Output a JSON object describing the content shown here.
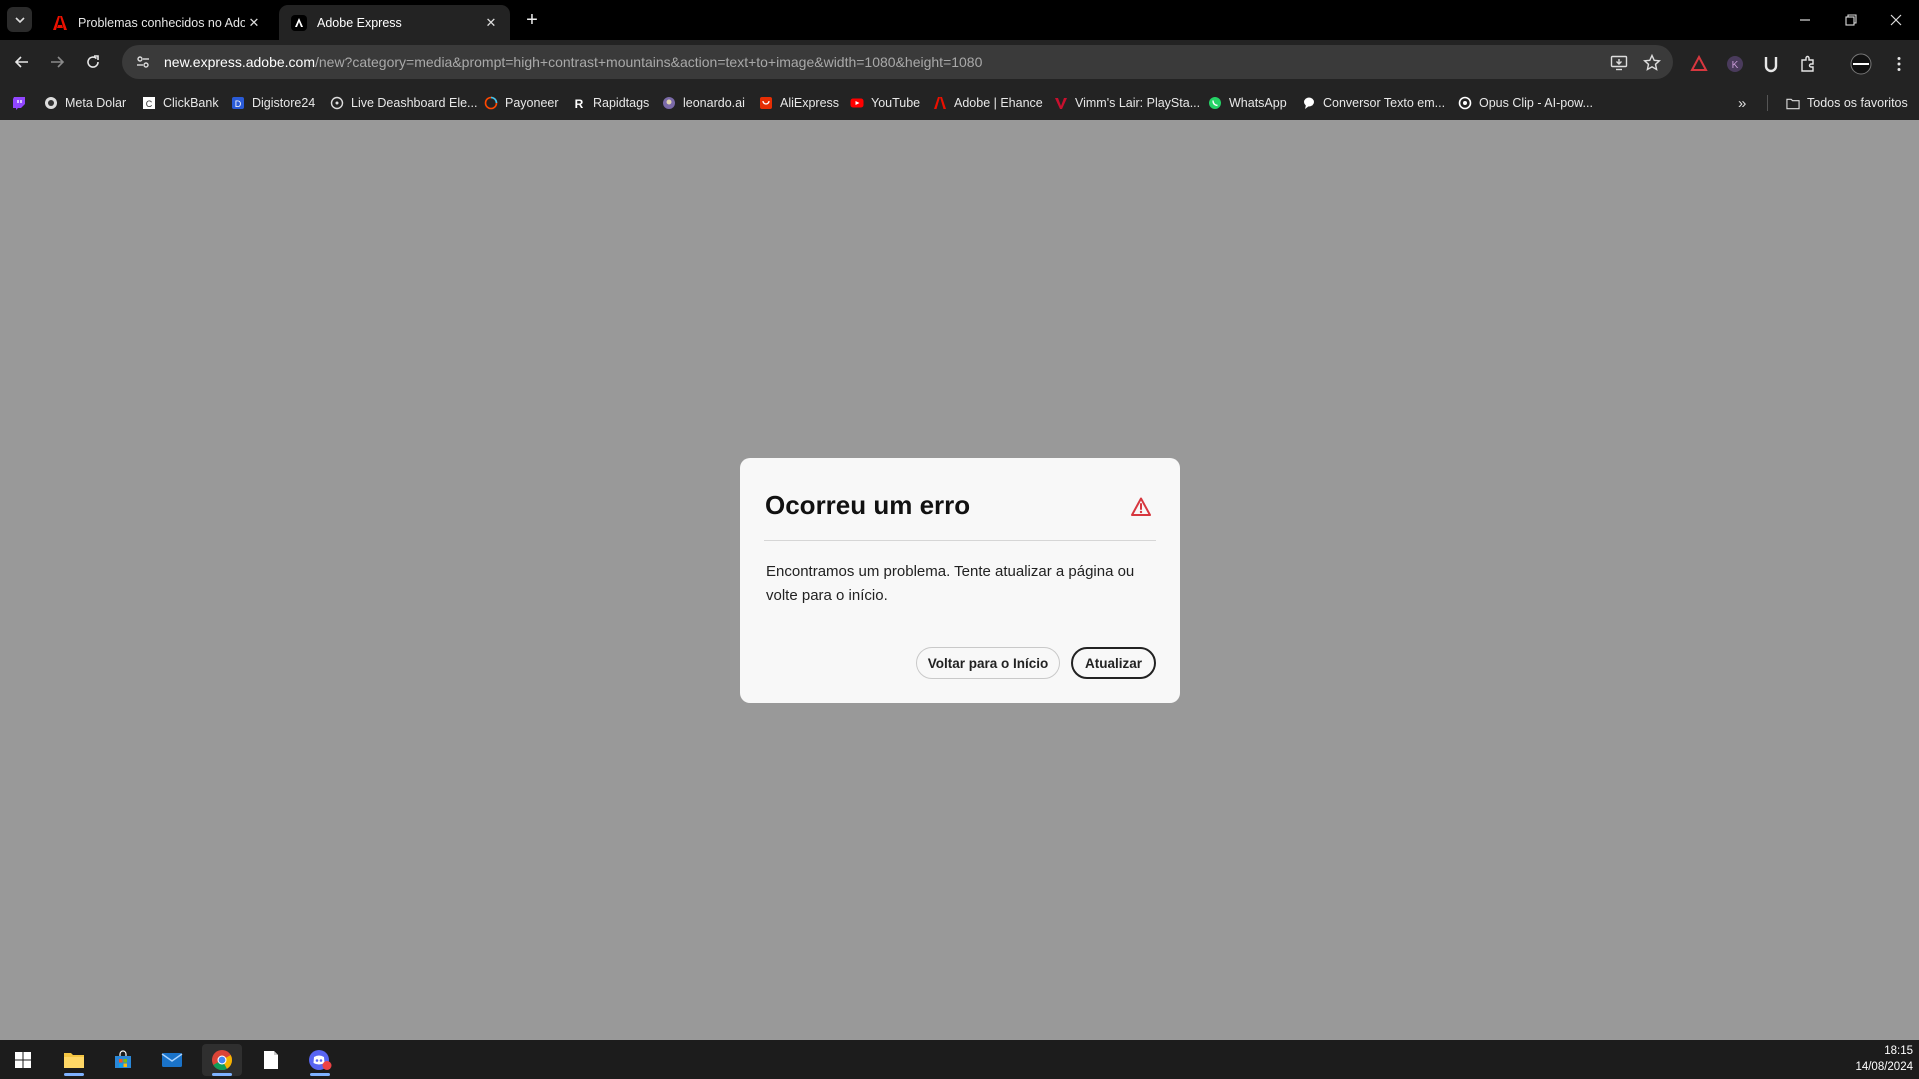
{
  "browser": {
    "tabs": [
      {
        "title": "Problemas conhecidos no Adobe",
        "active": false
      },
      {
        "title": "Adobe Express",
        "active": true
      }
    ],
    "url_host": "new.express.adobe.com",
    "url_path": "/new?category=media&prompt=high+contrast+mountains&action=text+to+image&width=1080&height=1080",
    "bookmarks": [
      {
        "label": "",
        "icon": "twitch-icon"
      },
      {
        "label": "Meta Dolar",
        "icon": "circle-icon"
      },
      {
        "label": "ClickBank",
        "icon": "clickbank-icon"
      },
      {
        "label": "Digistore24",
        "icon": "digistore-icon"
      },
      {
        "label": "Live Deashboard Ele...",
        "icon": "steering-icon"
      },
      {
        "label": "Payoneer",
        "icon": "payoneer-icon"
      },
      {
        "label": "Rapidtags",
        "icon": "rapidtags-icon"
      },
      {
        "label": "leonardo.ai",
        "icon": "leonardo-icon"
      },
      {
        "label": "AliExpress",
        "icon": "aliexpress-icon"
      },
      {
        "label": "YouTube",
        "icon": "youtube-icon"
      },
      {
        "label": "Adobe | Ehance",
        "icon": "adobe-icon"
      },
      {
        "label": "Vimm's Lair: PlaySta...",
        "icon": "vimm-icon"
      },
      {
        "label": "WhatsApp",
        "icon": "whatsapp-icon"
      },
      {
        "label": "Conversor Texto em...",
        "icon": "bubble-icon"
      },
      {
        "label": "Opus Clip - AI-pow...",
        "icon": "opus-icon"
      }
    ],
    "all_bookmarks_label": "Todos os favoritos"
  },
  "dialog": {
    "title": "Ocorreu um erro",
    "message": "Encontramos um problema. Tente atualizar a página ou volte para o início.",
    "secondary_button": "Voltar para o Início",
    "primary_button": "Atualizar"
  },
  "taskbar": {
    "time": "18:15",
    "date": "14/08/2024"
  },
  "colors": {
    "page_background": "#999999",
    "dialog_background": "#f8f8f8",
    "warning_red": "#d7373f",
    "chrome_dark": "#232323"
  }
}
